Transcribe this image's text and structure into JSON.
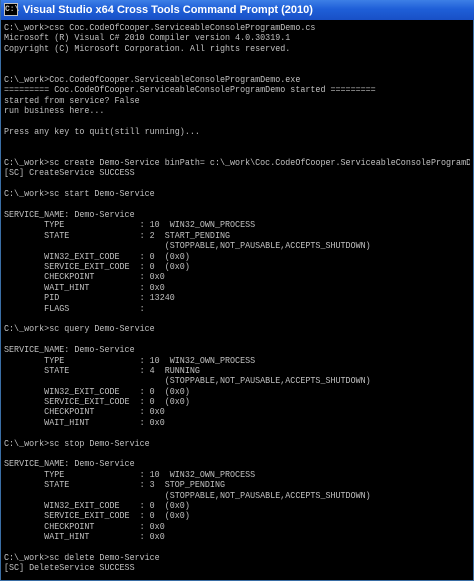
{
  "window": {
    "title": "Visual Studio x64 Cross Tools Command Prompt (2010)",
    "icon_label": "C:\\"
  },
  "console": {
    "lines": [
      "C:\\_work>csc Coc.CodeOfCooper.ServiceableConsoleProgramDemo.cs",
      "Microsoft (R) Visual C# 2010 Compiler version 4.0.30319.1",
      "Copyright (C) Microsoft Corporation. All rights reserved.",
      "",
      "",
      "C:\\_work>Coc.CodeOfCooper.ServiceableConsoleProgramDemo.exe",
      "========= Coc.CodeOfCooper.ServiceableConsoleProgramDemo started =========",
      "started from service? False",
      "run business here...",
      "",
      "Press any key to quit(still running)...",
      "",
      "",
      "C:\\_work>sc create Demo-Service binPath= c:\\_work\\Coc.CodeOfCooper.ServiceableConsoleProgramDemo.exe",
      "[SC] CreateService SUCCESS",
      "",
      "C:\\_work>sc start Demo-Service",
      "",
      "SERVICE_NAME: Demo-Service",
      "        TYPE               : 10  WIN32_OWN_PROCESS",
      "        STATE              : 2  START_PENDING",
      "                                (STOPPABLE,NOT_PAUSABLE,ACCEPTS_SHUTDOWN)",
      "        WIN32_EXIT_CODE    : 0  (0x0)",
      "        SERVICE_EXIT_CODE  : 0  (0x0)",
      "        CHECKPOINT         : 0x0",
      "        WAIT_HINT          : 0x0",
      "        PID                : 13240",
      "        FLAGS              :",
      "",
      "C:\\_work>sc query Demo-Service",
      "",
      "SERVICE_NAME: Demo-Service",
      "        TYPE               : 10  WIN32_OWN_PROCESS",
      "        STATE              : 4  RUNNING",
      "                                (STOPPABLE,NOT_PAUSABLE,ACCEPTS_SHUTDOWN)",
      "        WIN32_EXIT_CODE    : 0  (0x0)",
      "        SERVICE_EXIT_CODE  : 0  (0x0)",
      "        CHECKPOINT         : 0x0",
      "        WAIT_HINT          : 0x0",
      "",
      "C:\\_work>sc stop Demo-Service",
      "",
      "SERVICE_NAME: Demo-Service",
      "        TYPE               : 10  WIN32_OWN_PROCESS",
      "        STATE              : 3  STOP_PENDING",
      "                                (STOPPABLE,NOT_PAUSABLE,ACCEPTS_SHUTDOWN)",
      "        WIN32_EXIT_CODE    : 0  (0x0)",
      "        SERVICE_EXIT_CODE  : 0  (0x0)",
      "        CHECKPOINT         : 0x0",
      "        WAIT_HINT          : 0x0",
      "",
      "C:\\_work>sc delete Demo-Service",
      "[SC] DeleteService SUCCESS"
    ]
  }
}
